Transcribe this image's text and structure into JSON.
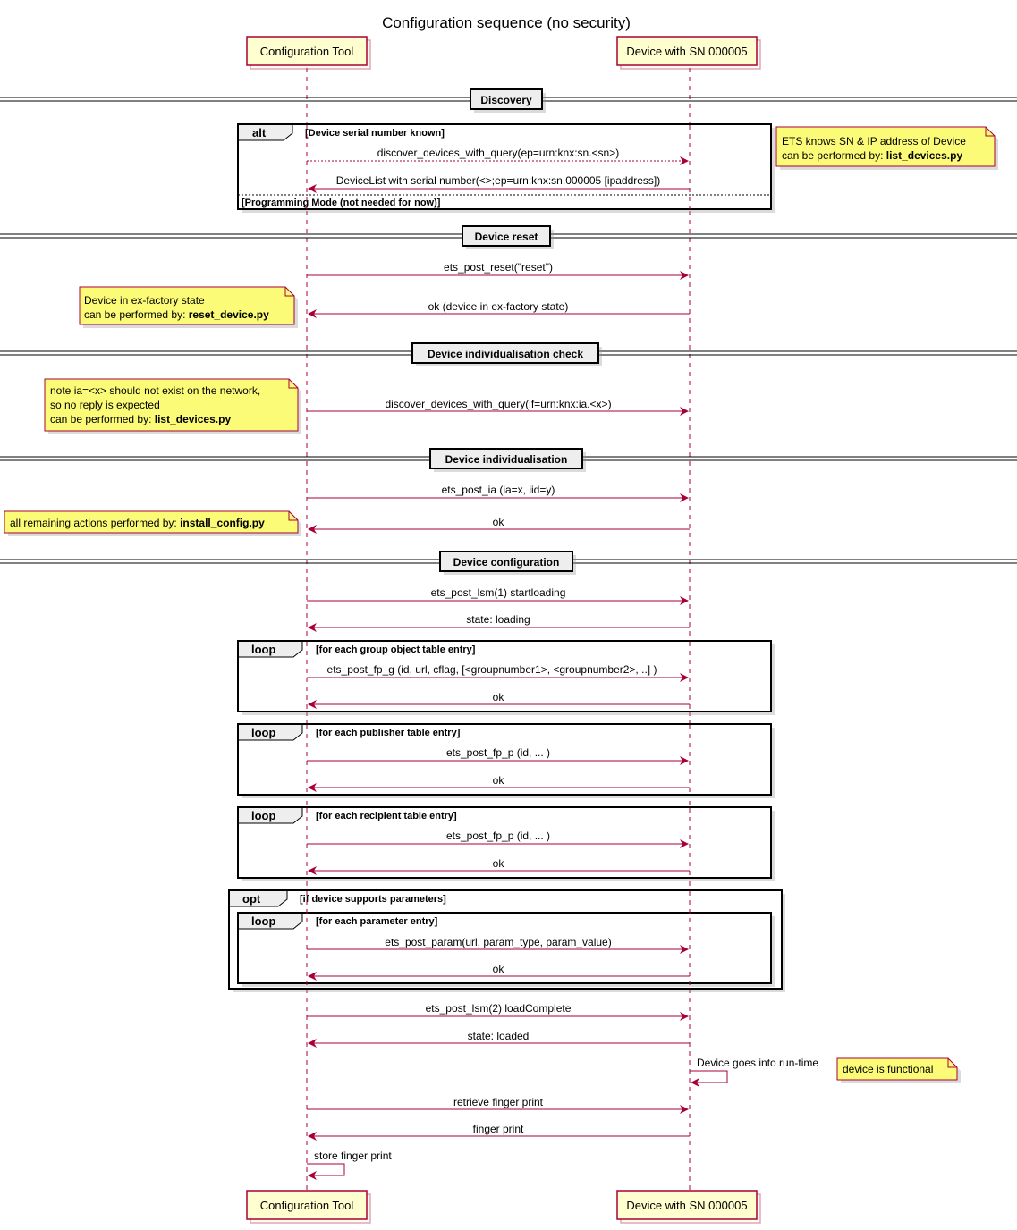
{
  "title": "Configuration sequence (no security)",
  "participants": [
    {
      "id": "tool",
      "label": "Configuration Tool"
    },
    {
      "id": "device",
      "label": "Device with SN 000005"
    }
  ],
  "dividers": {
    "discovery": "Discovery",
    "reset": "Device reset",
    "check": "Device individualisation check",
    "individualisation": "Device individualisation",
    "configuration": "Device configuration"
  },
  "fragments": {
    "alt": {
      "keyword": "alt",
      "guard": "[Device serial number known]",
      "else_guard": "[Programming Mode (not needed for now)]"
    },
    "loop_group": {
      "keyword": "loop",
      "guard": "[for each group object table entry]"
    },
    "loop_publisher": {
      "keyword": "loop",
      "guard": "[for each publisher table entry]"
    },
    "loop_recipient": {
      "keyword": "loop",
      "guard": "[for each recipient table entry]"
    },
    "opt": {
      "keyword": "opt",
      "guard": "[if device supports parameters]"
    },
    "loop_param": {
      "keyword": "loop",
      "guard": "[for each parameter entry]"
    }
  },
  "messages": {
    "discover_sn": "discover_devices_with_query(ep=urn:knx:sn.<sn>)",
    "devicelist": "DeviceList with serial number(<>;ep=urn:knx:sn.000005 [ipaddress])",
    "reset": "ets_post_reset(\"reset\")",
    "reset_ok": "ok (device in ex-factory state)",
    "discover_ia": "discover_devices_with_query(if=urn:knx:ia.<x>)",
    "post_ia": "ets_post_ia (ia=x, iid=y)",
    "post_ia_ok": "ok",
    "lsm1": "ets_post_lsm(1) startloading",
    "state_loading": "state: loading",
    "fp_g": "ets_post_fp_g (id, url, cflag, [<groupnumber1>, <groupnumber2>, ..]  )",
    "fp_g_ok": "ok",
    "fp_p_pub": "ets_post_fp_p (id, ...  )",
    "fp_p_pub_ok": "ok",
    "fp_p_rec": "ets_post_fp_p (id, ...  )",
    "fp_p_rec_ok": "ok",
    "param": "ets_post_param(url, param_type, param_value)",
    "param_ok": "ok",
    "lsm2": "ets_post_lsm(2) loadComplete",
    "state_loaded": "state: loaded",
    "runtime": "Device goes into run-time",
    "retrieve_fp": "retrieve finger print",
    "fp": "finger print",
    "store_fp": "store finger print"
  },
  "notes": {
    "ets_knows": {
      "line1": "ETS knows SN & IP address of Device",
      "prefix": "can be performed by: ",
      "script": "list_devices.py"
    },
    "factory": {
      "line1": "Device in ex-factory state",
      "prefix": "can be performed by: ",
      "script": "reset_device.py"
    },
    "ia_check": {
      "line1": "note ia=<x> should not exist on the network,",
      "line2": "so no reply is expected",
      "prefix": "can be performed by: ",
      "script": "list_devices.py"
    },
    "install": {
      "prefix": "all remaining actions performed by: ",
      "script": "install_config.py"
    },
    "functional": {
      "line1": "device is functional"
    }
  }
}
